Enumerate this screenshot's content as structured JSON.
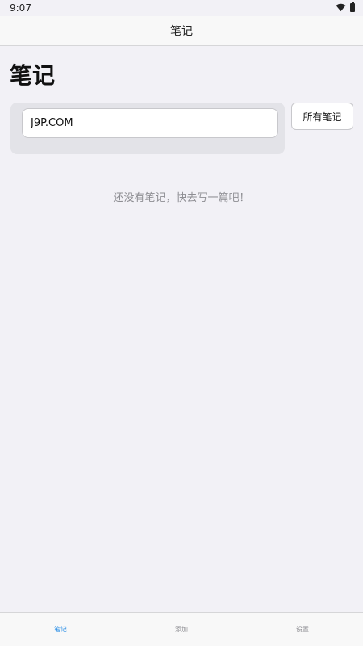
{
  "status": {
    "time": "9:07"
  },
  "nav": {
    "title": "笔记"
  },
  "page": {
    "title": "笔记"
  },
  "search": {
    "value": "J9P.COM"
  },
  "buttons": {
    "all_notes": "所有笔记"
  },
  "empty_state": {
    "message": "还没有笔记，快去写一篇吧！"
  },
  "tabs": [
    {
      "label": "笔记",
      "active": true
    },
    {
      "label": "添加",
      "active": false
    },
    {
      "label": "设置",
      "active": false
    }
  ],
  "colors": {
    "accent": "#1e88e5",
    "background": "#f2f1f6"
  },
  "icons": [
    "wifi-icon",
    "battery-icon"
  ]
}
